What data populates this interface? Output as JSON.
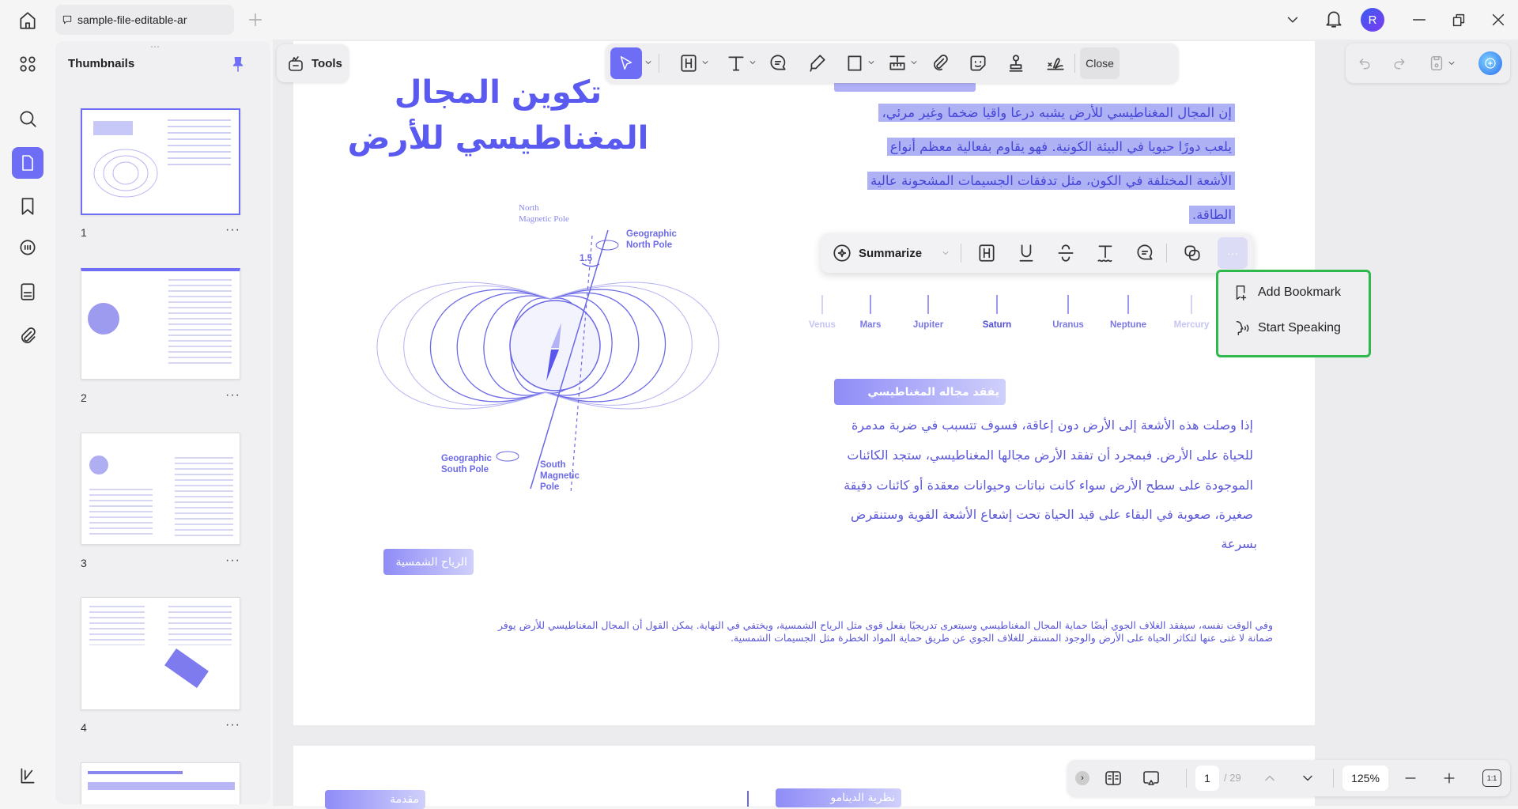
{
  "titlebar": {
    "tab_title": "sample-file-editable-ar",
    "avatar_letter": "R"
  },
  "thumbnails": {
    "title": "Thumbnails",
    "pages": [
      "1",
      "2",
      "3",
      "4"
    ],
    "more": "···"
  },
  "tools": {
    "label": "Tools"
  },
  "toolbar": {
    "close_label": "Close"
  },
  "document": {
    "title_line1": "تكوين المجال",
    "title_line2": "المغناطيسي للأرض",
    "highlighted_lines": [
      "إن المجال المغناطيسي للأرض يشبه درعا واقيا ضخما وغير مرئي،",
      "يلعب دورًا حيويا في البيئة الكونية. فهو يقاوم بفعالية معظم أنواع",
      "الأشعة المختلفة في الكون، مثل تدفقات الجسيمات المشحونة عالية",
      "الطاقة."
    ],
    "diagram": {
      "north_magnetic": "North",
      "north_magnetic2": "Magnetic Pole",
      "geo_north": "Geographic",
      "geo_north2": "North Pole",
      "angle": "1.5",
      "geo_south": "Geographic",
      "geo_south2": "South Pole",
      "south_magnetic": "South",
      "south_magnetic2": "Magnetic",
      "south_magnetic3": "Pole"
    },
    "planets": [
      "Venus",
      "Mars",
      "Jupiter",
      "Saturn",
      "Uranus",
      "Neptune",
      "Mercury"
    ],
    "section_heading": "يفقد مجاله المغناطيسي",
    "section_lines": [
      "إذا وصلت هذه الأشعة إلى الأرض دون إعاقة، فسوف تتسبب في ضربة مدمرة",
      "للحياة على الأرض. فبمجرد أن تفقد الأرض مجالها المغناطيسي، ستجد الكائنات",
      "الموجودة على سطح الأرض سواء كانت نباتات وحيوانات معقدة أو كائنات دقيقة",
      "صغيرة، صعوبة في البقاء على قيد الحياة تحت إشعاع الأشعة القوية وستنقرض",
      "بسرعة"
    ],
    "solar_wind_heading": "الرياح الشمسية",
    "bottom_lines": [
      "وفي الوقت نفسه، سيفقد الغلاف الجوي أيضًا حماية المجال المغناطيسي وسيتعرى تدريجيًا بفعل قوى مثل الرياح الشمسية، ويختفي في النهاية. يمكن القول أن المجال المغناطيسي للأرض يوفر",
      "ضمانة لا غنى عنها لتكاثر الحياة على الأرض والوجود المستقر للغلاف الجوي عن طريق حماية المواد الخطرة مثل الجسيمات الشمسية."
    ],
    "page2_heading_right": "نظرية الدينامو",
    "page2_heading_left": "مقدمة"
  },
  "selection_bar": {
    "summarize": "Summarize",
    "more": "···"
  },
  "context_menu": {
    "items": [
      {
        "label": "Add Bookmark",
        "icon": "bookmark-add-icon"
      },
      {
        "label": "Start Speaking",
        "icon": "speak-icon"
      }
    ]
  },
  "navbar": {
    "current_page": "1",
    "total_pages": "/ 29",
    "zoom": "125%",
    "fit": "1:1"
  },
  "colors": {
    "accent": "#6d6df5",
    "highlight": "#aeb2f4",
    "menu_border": "#2fb84c",
    "text_blue": "#4646d8"
  }
}
